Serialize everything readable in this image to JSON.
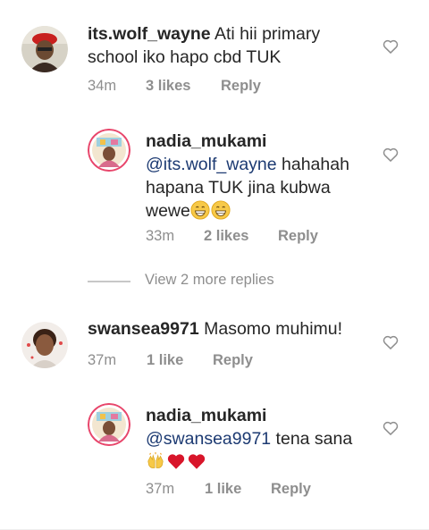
{
  "comments": [
    {
      "username": "its.wolf_wayne",
      "text_line1": "Ati hii primary",
      "text_line2": "school iko hapo cbd TUK",
      "time": "34m",
      "likes": "3 likes",
      "reply": "Reply"
    },
    {
      "username": "nadia_mukami",
      "mention": "@its.wolf_wayne",
      "text_line1_rest": " hahahah",
      "text_line2": "hapana TUK jina kubwa",
      "text_line3": "wewe",
      "time": "33m",
      "likes": "2 likes",
      "reply": "Reply"
    },
    {
      "username": "swansea9971",
      "text": " Masomo muhimu!",
      "time": "37m",
      "likes": "1 like",
      "reply": "Reply"
    },
    {
      "username": "nadia_mukami",
      "mention": "@swansea9971",
      "text_rest": " tena sana",
      "time": "37m",
      "likes": "1 like",
      "reply": "Reply"
    }
  ],
  "view_more": "View 2 more replies",
  "icons": {
    "like": "heart-outline-icon",
    "grin": "grinning-face-emoji",
    "hands": "raising-hands-emoji",
    "red_heart": "red-heart-emoji"
  },
  "colors": {
    "text": "#262626",
    "meta": "#8e8e8e",
    "mention": "#1c3a72",
    "story_ring": "#e8466b"
  }
}
